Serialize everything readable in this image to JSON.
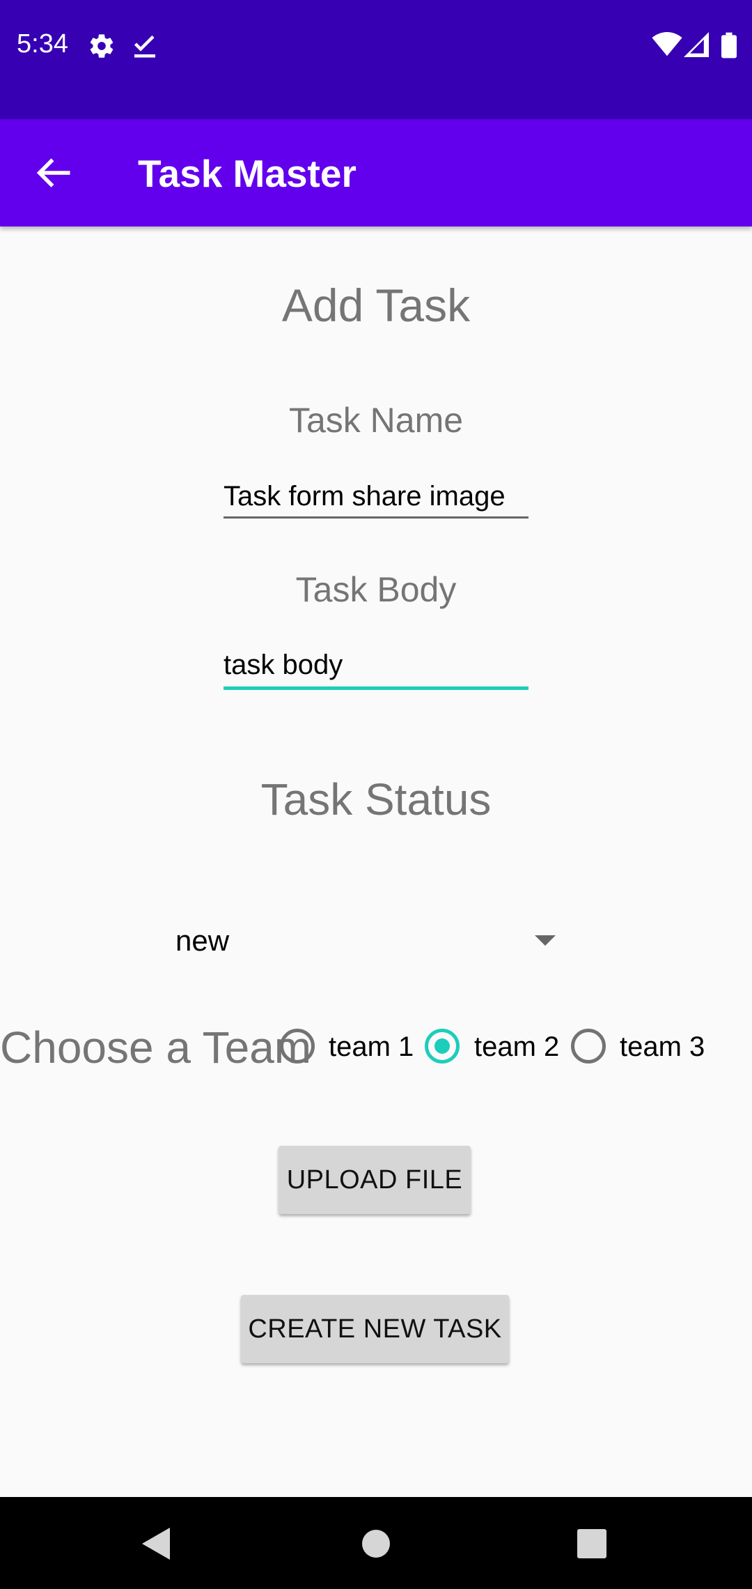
{
  "status_bar": {
    "time": "5:34",
    "icons": [
      "gear-icon",
      "check-download-icon",
      "wifi-icon",
      "signal-icon",
      "battery-icon"
    ]
  },
  "app_bar": {
    "back_icon": "arrow-left-icon",
    "title": "Task Master"
  },
  "form": {
    "heading": "Add Task",
    "task_name_label": "Task Name",
    "task_name_value": "Task form share image",
    "task_body_label": "Task Body",
    "task_body_value": "task body",
    "task_status_label": "Task Status",
    "status_selected": "new",
    "team_label": "Choose a Team",
    "teams": [
      {
        "label": "team 1",
        "checked": false
      },
      {
        "label": "team 2",
        "checked": true
      },
      {
        "label": "team 3",
        "checked": false
      }
    ],
    "upload_button": "UPLOAD FILE",
    "create_button": "CREATE NEW TASK"
  },
  "colors": {
    "status_bar": "#3700b3",
    "app_bar": "#6200ee",
    "accent": "#1ccdba",
    "button": "#d6d6d6"
  },
  "nav_bar": {
    "icons": [
      "back-triangle-icon",
      "home-circle-icon",
      "recents-square-icon"
    ]
  }
}
